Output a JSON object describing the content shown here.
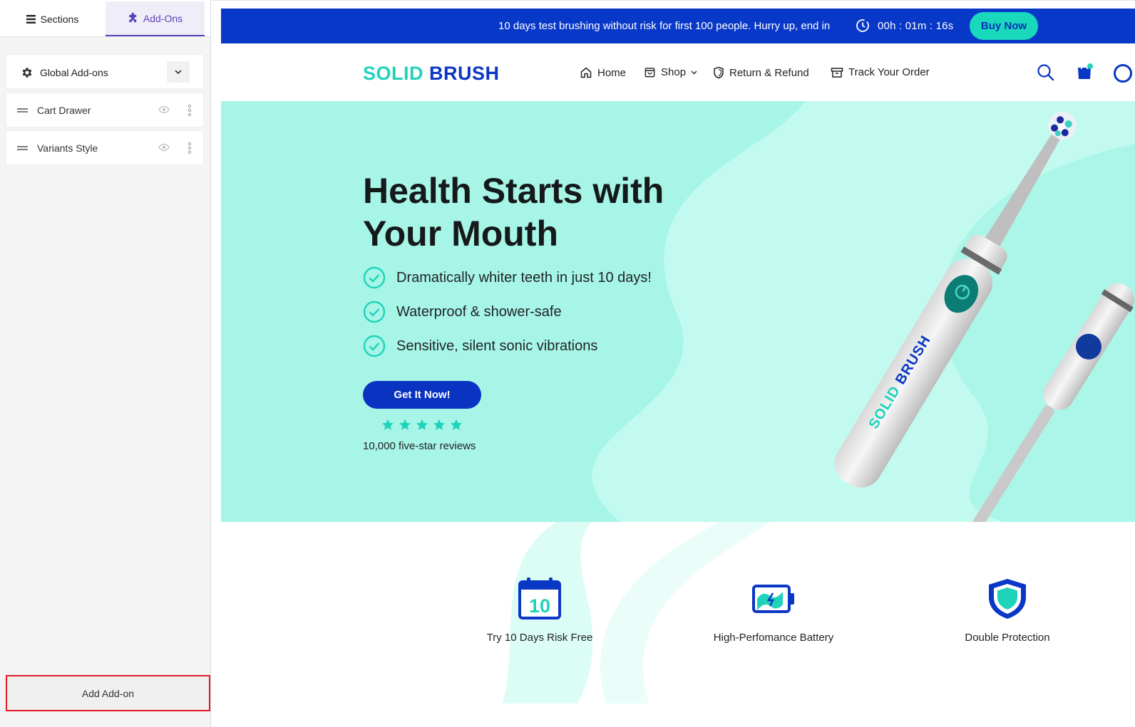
{
  "editor": {
    "tabs": [
      {
        "label": "Sections",
        "active": false
      },
      {
        "label": "Add-Ons",
        "active": true
      }
    ],
    "global_addons_label": "Global Add-ons",
    "addons": [
      {
        "label": "Cart Drawer"
      },
      {
        "label": "Variants Style"
      }
    ],
    "add_addon_label": "Add Add-on",
    "accent_color": "#5a3fb8",
    "highlight_color": "#e01b24"
  },
  "preview": {
    "announcement": {
      "message": "10 days test brushing without risk for first 100 people. Hurry up, end in",
      "timer": "00h : 01m : 16s",
      "button_label": "Buy Now",
      "bar_color": "#0838c8"
    },
    "header": {
      "logo_part1": "SOLID",
      "logo_part2": "BRUSH",
      "nav": [
        {
          "label": "Home",
          "icon": "home-icon"
        },
        {
          "label": "Shop",
          "icon": "shop-bag-icon"
        },
        {
          "label": "Return & Refund",
          "icon": "shield-icon"
        },
        {
          "label": "Track Your Order",
          "icon": "box-icon"
        }
      ]
    },
    "hero": {
      "title": "Health Starts with Your Mouth",
      "features": [
        "Dramatically whiter teeth in just 10 days!",
        "Waterproof & shower-safe",
        "Sensitive, silent sonic vibrations"
      ],
      "cta_label": "Get It Now!",
      "rating": 5,
      "reviews": "10,000 five-star reviews",
      "brand_on_product": "SOLID BRUSH",
      "bg_color": "#a7f5e7"
    },
    "features": [
      {
        "label": "Try 10 Days Risk Free",
        "icon": "calendar-icon",
        "icon_text": "10"
      },
      {
        "label": "High-Perfomance Battery",
        "icon": "battery-icon"
      },
      {
        "label": "Double Protection",
        "icon": "shield-icon"
      }
    ]
  }
}
